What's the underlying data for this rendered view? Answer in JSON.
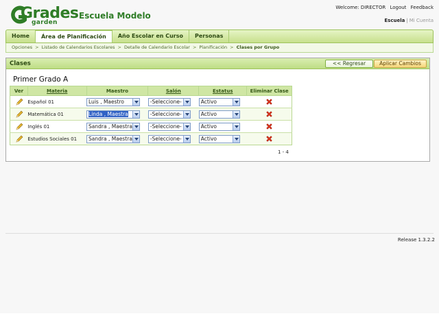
{
  "header": {
    "logo_word": "Grades",
    "logo_sub": "garden",
    "school_name": "Escuela Modelo",
    "welcome": "Welcome: DIRECTOR",
    "logout": "Logout",
    "feedback": "Feedback",
    "school_link": "Escuela",
    "account_link": "Mi Cuenta"
  },
  "nav": {
    "tabs": [
      {
        "label": "Home"
      },
      {
        "label": "Área de Planificación"
      },
      {
        "label": "Año Escolar en Curso"
      },
      {
        "label": "Personas"
      }
    ],
    "active": "Área de Planificación"
  },
  "breadcrumb": {
    "items": [
      "Opciones",
      "Listado de Calendarios Escolares",
      "Detalle de Calendario Escolar",
      "Planificación"
    ],
    "current": "Clases por Grupo"
  },
  "panel": {
    "title": "Clases",
    "back_button": "<< Regresar",
    "apply_button": "Aplicar Cambios",
    "group_title": "Primer Grado A",
    "pager": "1 - 4"
  },
  "table": {
    "headers": {
      "ver": "Ver",
      "materia": "Materia",
      "maestro": "Maestro",
      "salon": "Salón",
      "estatus": "Estatus",
      "eliminar": "Eliminar Clase"
    },
    "rows": [
      {
        "materia": "Español 01",
        "maestro": "Luis , Maestro",
        "salon": "-Seleccione-",
        "estatus": "Activo"
      },
      {
        "materia": "Matemática 01",
        "maestro": "Linda , Maestra",
        "salon": "-Seleccione-",
        "estatus": "Activo"
      },
      {
        "materia": "Inglés 01",
        "maestro": "Sandra , Maestra",
        "salon": "-Seleccione-",
        "estatus": "Activo"
      },
      {
        "materia": "Estudios Sociales 01",
        "maestro": "Sandra , Maestra",
        "salon": "-Seleccione-",
        "estatus": "Activo"
      }
    ]
  },
  "footer": {
    "release": "Release 1.3.2.2"
  },
  "icons": {
    "edit": "pencil-icon",
    "delete": "red-x-icon",
    "dropdown": "chevron-down-icon"
  },
  "colors": {
    "brand_green": "#2f7d27",
    "nav_bg": "#c7e08c",
    "selection_blue": "#3162c5",
    "delete_red": "#d9341e"
  }
}
